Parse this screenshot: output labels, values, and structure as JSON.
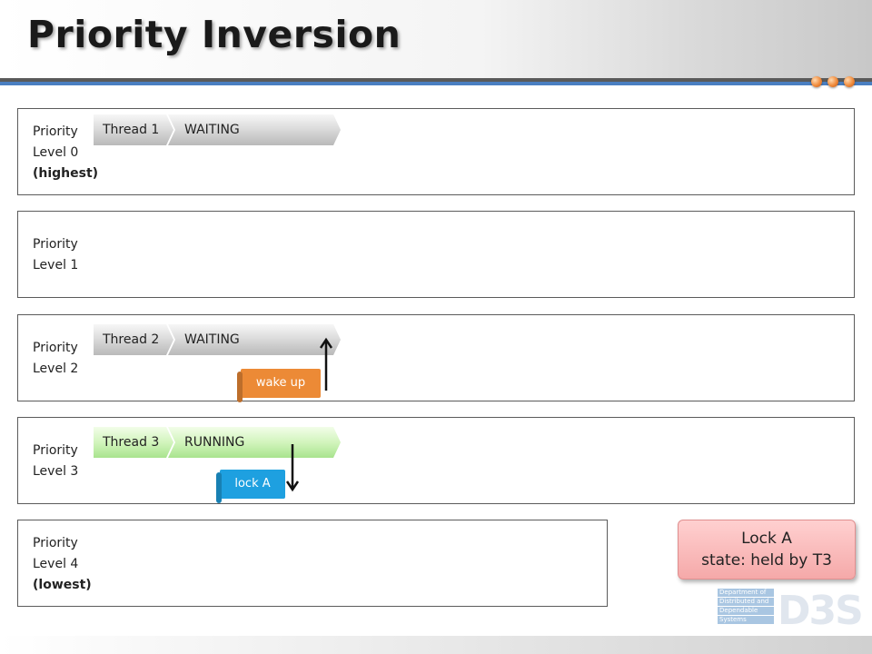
{
  "title": "Priority Inversion",
  "colors": {
    "accent_blue": "#4a7fc1",
    "waiting_gray": "#c8c8c8",
    "running_green": "#c6efb0",
    "wake_orange": "#ec8a36",
    "lock_blue": "#1ea0e0",
    "lock_box_pink": "#f7b3b3"
  },
  "lanes": [
    {
      "label_1": "Priority",
      "label_2": "Level 0",
      "label_3": "(highest)"
    },
    {
      "label_1": "Priority",
      "label_2": "Level 1"
    },
    {
      "label_1": "Priority",
      "label_2": "Level 2"
    },
    {
      "label_1": "Priority",
      "label_2": "Level 3"
    },
    {
      "label_1": "Priority",
      "label_2": "Level 4",
      "label_3": "(lowest)"
    }
  ],
  "threads": [
    {
      "name": "Thread 1",
      "state": "WAITING",
      "lane": 0
    },
    {
      "name": "Thread 2",
      "state": "WAITING",
      "lane": 2
    },
    {
      "name": "Thread 3",
      "state": "RUNNING",
      "lane": 3
    }
  ],
  "events": {
    "wake_up": "wake up",
    "lock_a": "lock A"
  },
  "lock_box": {
    "line_1": "Lock A",
    "line_2": "state: held by T3"
  },
  "logo": {
    "line_1": "Department of",
    "line_2": "Distributed and",
    "line_3": "Dependable",
    "line_4": "Systems",
    "mark": "D3S"
  },
  "icons": {
    "title_dots": "orange-dots-icon",
    "arrow_up": "arrow-up-icon",
    "arrow_down": "arrow-down-icon"
  }
}
